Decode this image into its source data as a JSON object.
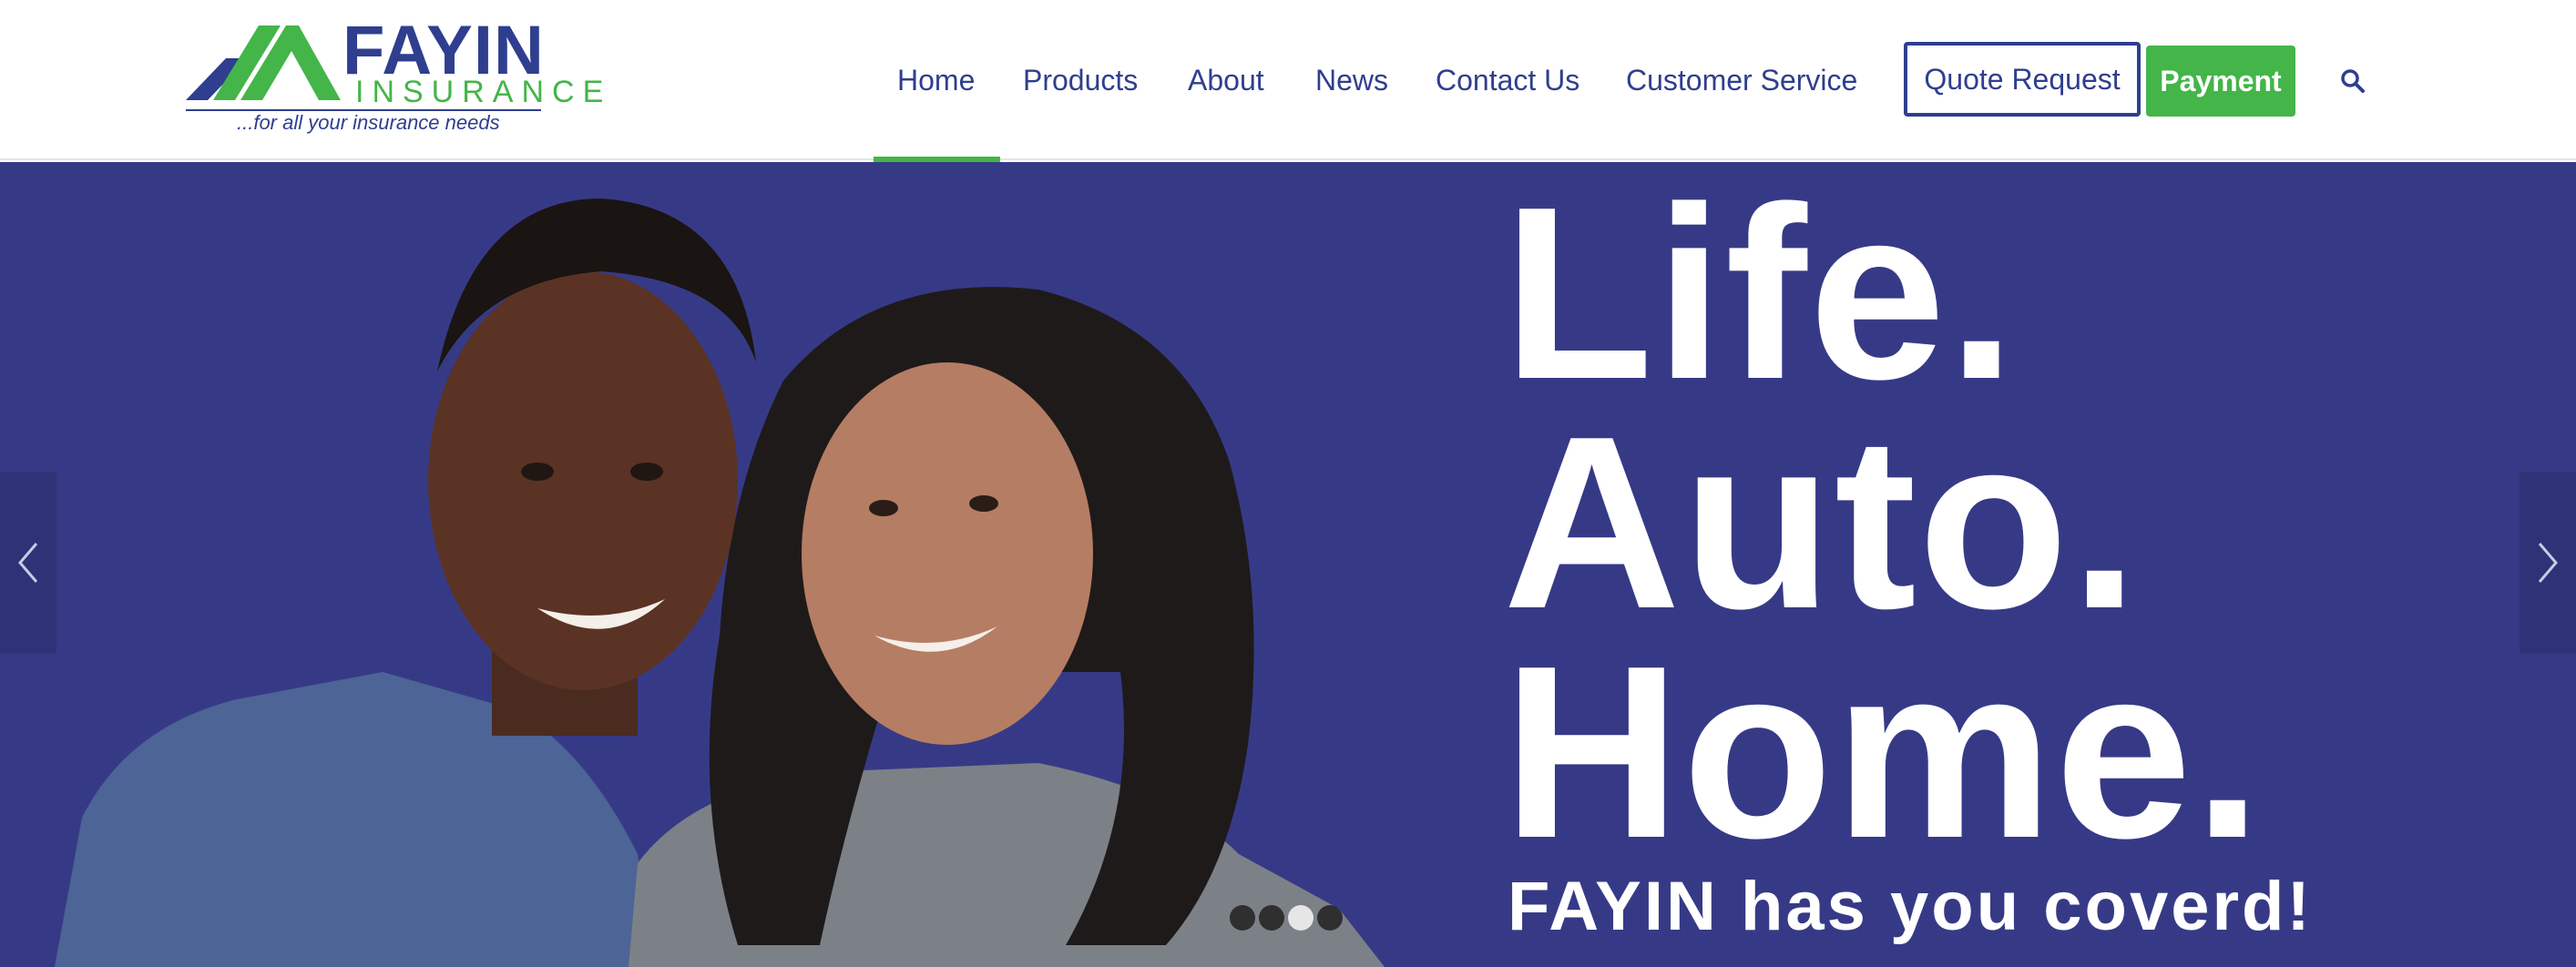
{
  "logo": {
    "name": "FAYIN",
    "subname": "INSURANCE",
    "tagline": "...for all your insurance needs"
  },
  "nav": {
    "items": [
      {
        "label": "Home",
        "active": true
      },
      {
        "label": "Products"
      },
      {
        "label": "About"
      },
      {
        "label": "News"
      },
      {
        "label": "Contact Us"
      },
      {
        "label": "Customer Service"
      }
    ],
    "quote_label": "Quote Request",
    "payment_label": "Payment",
    "search_icon": "search-icon"
  },
  "hero": {
    "lines": [
      "Life.",
      "Auto.",
      "Home."
    ],
    "subtitle": "FAYIN has you coverd!",
    "prev_icon": "chevron-left-icon",
    "next_icon": "chevron-right-icon",
    "slides_total": 4,
    "active_slide": 3
  },
  "colors": {
    "brand_blue": "#2f3e8f",
    "brand_green": "#44b549",
    "hero_bg": "#363a86"
  }
}
